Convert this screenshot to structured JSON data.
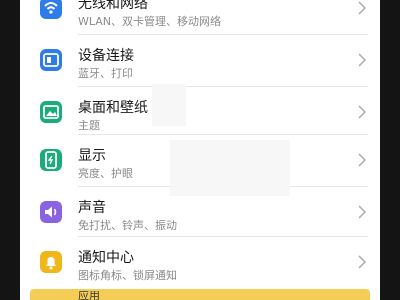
{
  "settings": {
    "items": [
      {
        "title": "无线和网络",
        "subtitle": "WLAN、双卡管理、移动网络",
        "icon": "wifi-icon",
        "color": "#2f7be8"
      },
      {
        "title": "设备连接",
        "subtitle": "蓝牙、打印",
        "icon": "device-connection-icon",
        "color": "#2f7be8"
      },
      {
        "title": "桌面和壁纸",
        "subtitle": "主题",
        "icon": "wallpaper-icon",
        "color": "#1cab7a"
      },
      {
        "title": "显示",
        "subtitle": "亮度、护眼",
        "icon": "display-icon",
        "color": "#1cab7a"
      },
      {
        "title": "声音",
        "subtitle": "免打扰、铃声、振动",
        "icon": "sound-icon",
        "color": "#8a63e0"
      },
      {
        "title": "通知中心",
        "subtitle": "图标角标、锁屏通知",
        "icon": "bell-icon",
        "color": "#f0b71b"
      },
      {
        "title": "应用",
        "subtitle": "",
        "icon": "apps-icon",
        "color": "#f4cd57"
      }
    ]
  }
}
